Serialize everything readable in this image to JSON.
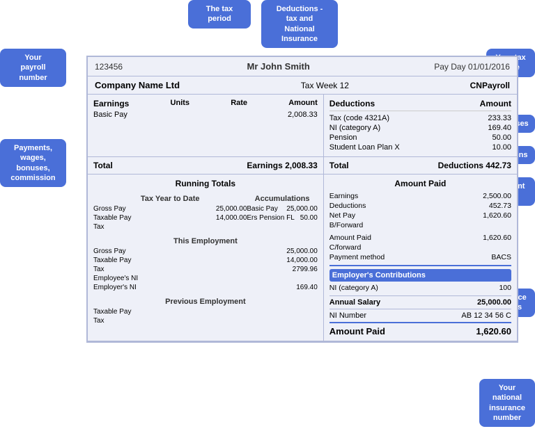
{
  "callouts": {
    "payroll": "Your\npayroll\nnumber",
    "tax_period": "The tax\nperiod",
    "deductions": "Deductions -\ntax and\nNational\nInsurance",
    "tax_code": "Your tax\ncode",
    "expenses": "Expenses",
    "pensions": "Pensions",
    "student_loan": "Student\nloan",
    "payments": "Payments,\nwages,\nbonuses,\ncommission",
    "workplace": "Workplace\nbenefits",
    "ni_number": "Your\nnational\ninsurance\nnumber"
  },
  "header": {
    "payroll_number": "123456",
    "name": "Mr John Smith",
    "payday": "Pay Day 01/01/2016",
    "company": "Company Name Ltd",
    "tax_week": "Tax Week 12",
    "cn_payroll": "CNPayroll"
  },
  "earnings": {
    "title": "Earnings",
    "col_units": "Units",
    "col_rate": "Rate",
    "col_amount": "Amount",
    "items": [
      {
        "description": "Basic Pay",
        "units": "",
        "rate": "",
        "amount": "2,008.33"
      }
    ],
    "total_label": "Total",
    "total_earnings_label": "Earnings 2,008.33"
  },
  "deductions": {
    "title": "Deductions",
    "col_amount": "Amount",
    "items": [
      {
        "description": "Tax (code 4321A)",
        "amount": "233.33"
      },
      {
        "description": "NI (category A)",
        "amount": "169.40"
      },
      {
        "description": "Pension",
        "amount": "50.00"
      },
      {
        "description": "Student Loan Plan X",
        "amount": "10.00"
      }
    ],
    "total_label": "Total",
    "total_deductions_label": "Deductions 442.73"
  },
  "running_totals": {
    "title": "Running Totals",
    "tax_year_label": "Tax Year to Date",
    "accumulations_label": "Accumulations",
    "ytd_items": [
      {
        "label": "Gross Pay",
        "value": "25,000.00"
      },
      {
        "label": "Taxable Pay",
        "value": "14,000.00"
      },
      {
        "label": "Tax",
        "value": ""
      }
    ],
    "accum_items": [
      {
        "label": "Basic Pay",
        "value": "25,000.00"
      },
      {
        "label": "Ers Pension FL",
        "value": "50.00"
      }
    ],
    "this_employment_label": "This Employment",
    "this_emp_items": [
      {
        "label": "Gross Pay",
        "value": "25,000.00"
      },
      {
        "label": "Taxable Pay",
        "value": "14,000.00"
      },
      {
        "label": "Tax",
        "value": "2799.96"
      },
      {
        "label": "Employee's NI",
        "value": ""
      },
      {
        "label": "Employer's NI",
        "value": "169.40"
      }
    ],
    "prev_employment_label": "Previous Employment",
    "prev_emp_items": [
      {
        "label": "Taxable Pay",
        "value": ""
      },
      {
        "label": "Tax",
        "value": ""
      }
    ]
  },
  "amount_paid": {
    "title": "Amount Paid",
    "items": [
      {
        "label": "Earnings",
        "value": "2,500.00"
      },
      {
        "label": "Deductions",
        "value": "452.73"
      },
      {
        "label": "Net Pay",
        "value": "1,620.60"
      },
      {
        "label": "B/Forward",
        "value": ""
      }
    ],
    "items2": [
      {
        "label": "Amount Paid",
        "value": "1,620.60"
      },
      {
        "label": "C/forward",
        "value": ""
      },
      {
        "label": "Payment method",
        "value": "BACS"
      }
    ]
  },
  "employer_contributions": {
    "title": "Employer's Contributions",
    "items": [
      {
        "label": "NI (category A)",
        "value": "100"
      }
    ]
  },
  "annual_salary": {
    "label": "Annual Salary",
    "value": "25,000.00"
  },
  "ni_number": {
    "label": "NI Number",
    "value": "AB 12 34 56 C"
  },
  "amount_paid_final": {
    "label": "Amount Paid",
    "value": "1,620.60"
  }
}
